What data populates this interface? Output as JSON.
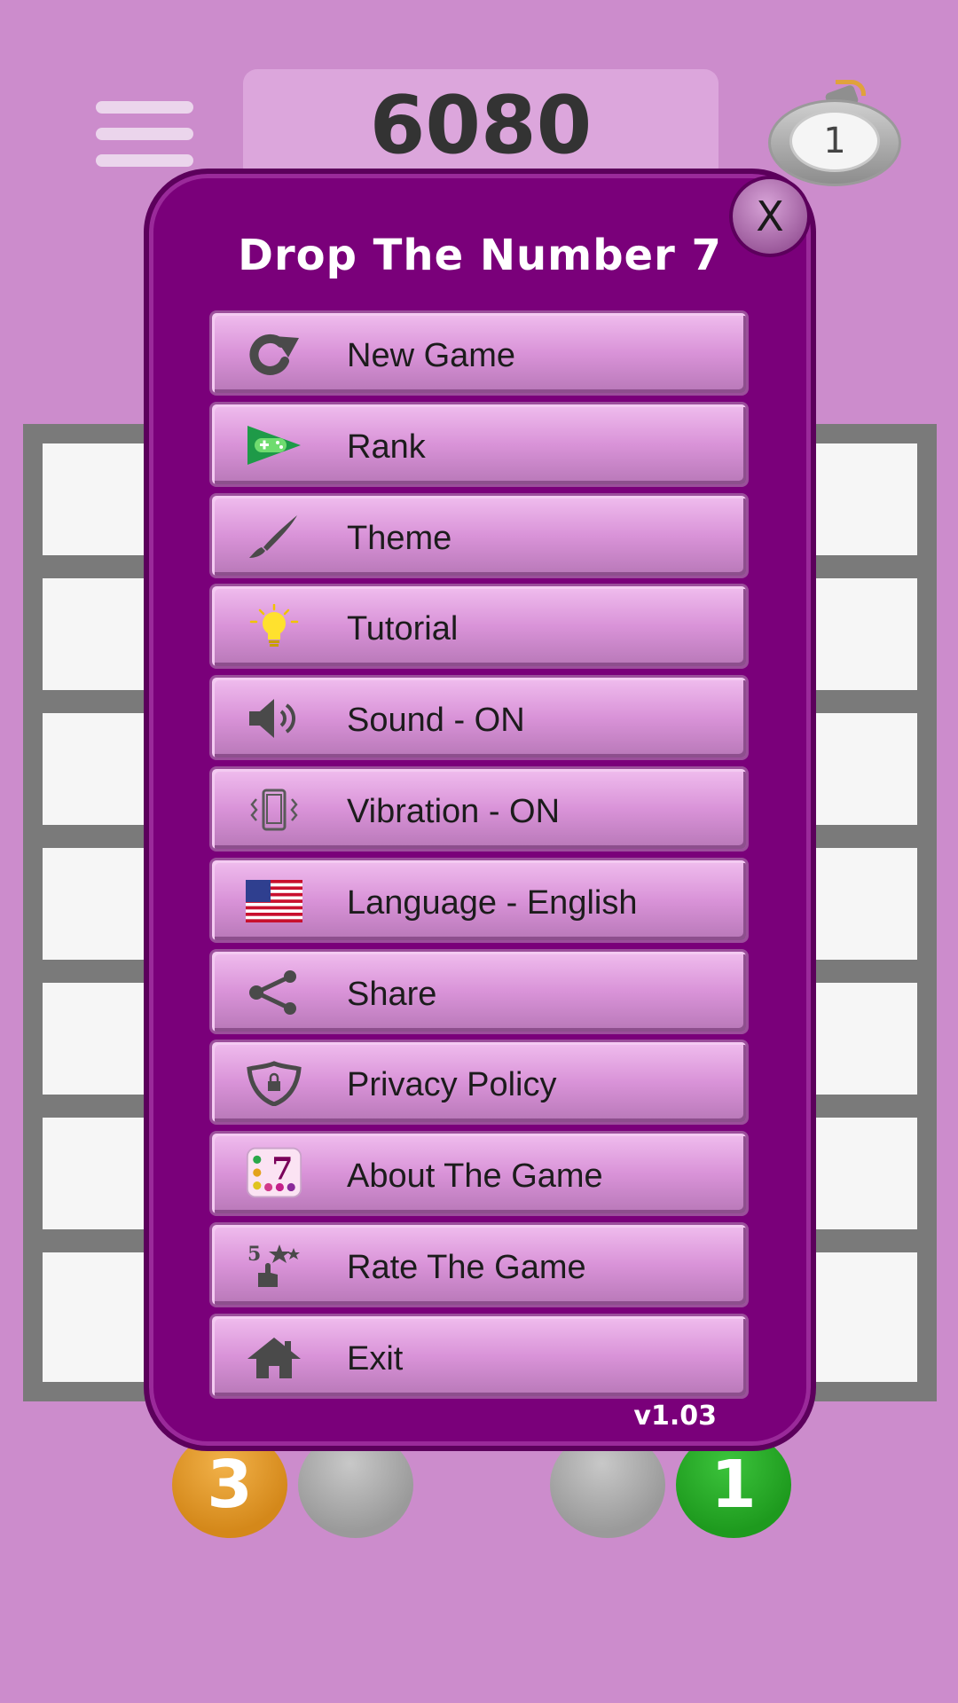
{
  "score": "6080",
  "bomb_count": "1",
  "next_balls": [
    {
      "label": "3",
      "color": "#e39a2c"
    },
    {
      "label": "",
      "color": "#b0b0b0"
    },
    {
      "label": "",
      "color": "#b0b0b0"
    },
    {
      "label": "1",
      "color": "#27ad27"
    }
  ],
  "menu": {
    "title": "Drop The Number 7",
    "close_label": "X",
    "version": "v1.03",
    "items": [
      {
        "label": "New Game",
        "icon": "restart-icon"
      },
      {
        "label": "Rank",
        "icon": "game-controller-icon"
      },
      {
        "label": "Theme",
        "icon": "brush-icon"
      },
      {
        "label": "Tutorial",
        "icon": "lightbulb-icon"
      },
      {
        "label": "Sound - ON",
        "icon": "speaker-icon"
      },
      {
        "label": "Vibration - ON",
        "icon": "vibration-icon"
      },
      {
        "label": "Language - English",
        "icon": "us-flag-icon"
      },
      {
        "label": "Share",
        "icon": "share-icon"
      },
      {
        "label": "Privacy Policy",
        "icon": "shield-icon"
      },
      {
        "label": "About The Game",
        "icon": "app-logo-icon",
        "icon_text": "7"
      },
      {
        "label": "Rate The Game",
        "icon": "rate-stars-icon",
        "icon_text": "5"
      },
      {
        "label": "Exit",
        "icon": "home-icon"
      }
    ]
  },
  "colors": {
    "background": "#cc8ccc",
    "panel": "#7a007a",
    "button": "#d993d8"
  }
}
